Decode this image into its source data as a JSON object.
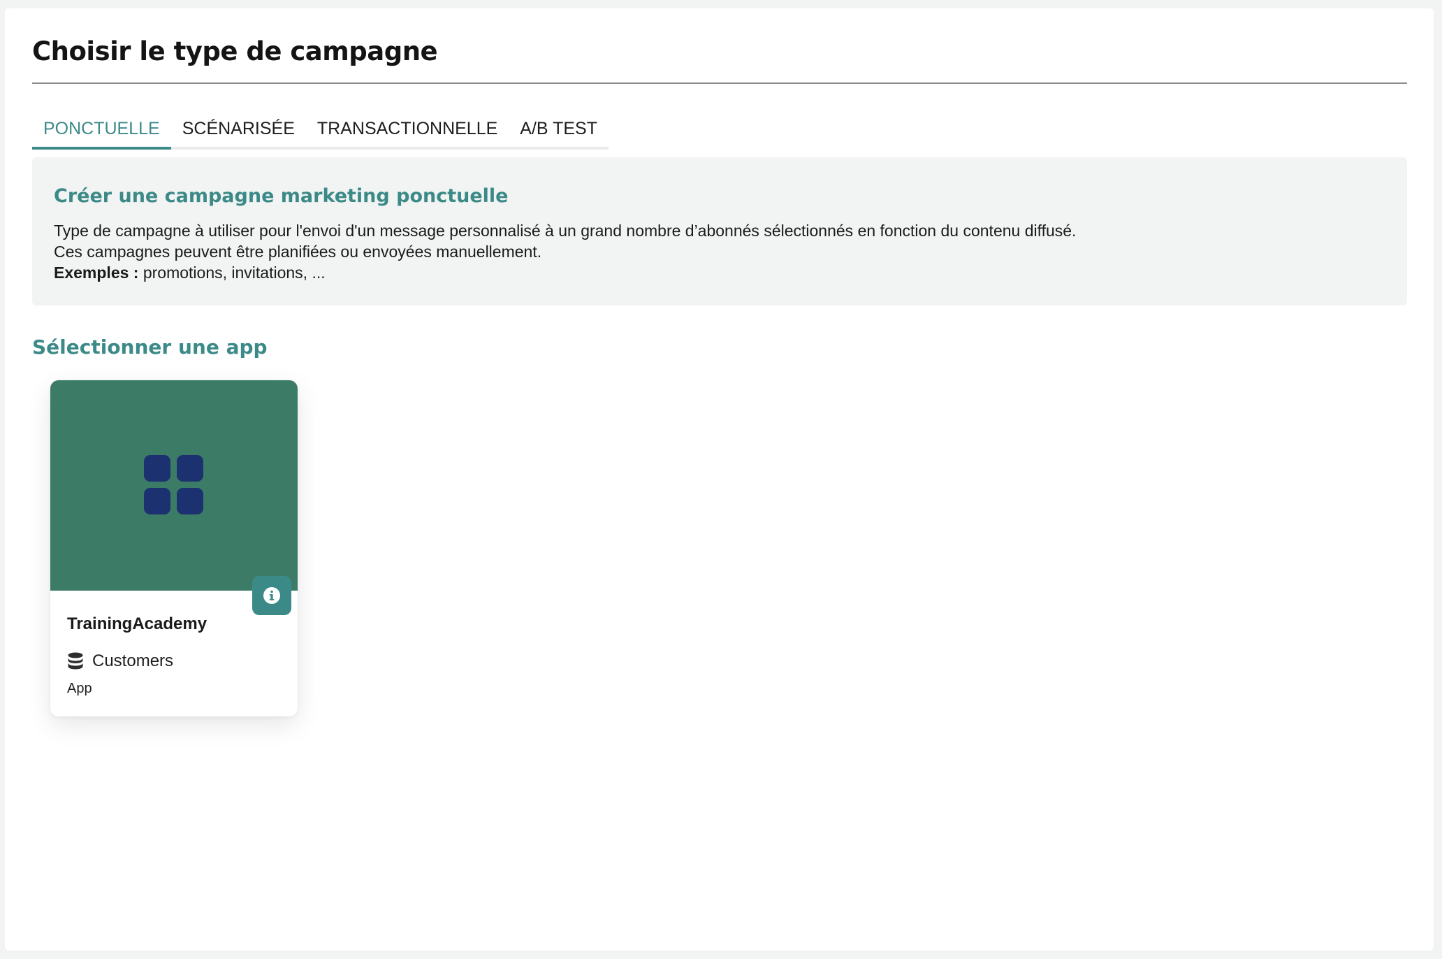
{
  "page": {
    "title": "Choisir le type de campagne"
  },
  "tabs": [
    {
      "label": "PONCTUELLE",
      "active": true
    },
    {
      "label": "SCÉNARISÉE",
      "active": false
    },
    {
      "label": "TRANSACTIONNELLE",
      "active": false
    },
    {
      "label": "A/B TEST",
      "active": false
    }
  ],
  "info": {
    "title": "Créer une campagne marketing ponctuelle",
    "line1": "Type de campagne à utiliser pour l'envoi d'un message personnalisé à un grand nombre d’abonnés sélectionnés en fonction du contenu diffusé.",
    "line2": "Ces campagnes peuvent être planifiées ou envoyées manuellement.",
    "examples_label": "Exemples :",
    "examples_text": " promotions, invitations, ..."
  },
  "apps_section": {
    "title": "Sélectionner une app",
    "cards": [
      {
        "name": "TrainingAcademy",
        "database": "Customers",
        "type": "App",
        "thumb_icon": "apps-grid-icon",
        "info_icon": "info-icon",
        "database_icon": "database-icon"
      }
    ]
  },
  "colors": {
    "accent": "#3c8a88",
    "card_thumb": "#3c7b66",
    "grid_icon": "#1c3170",
    "info_box_bg": "#f2f4f3"
  }
}
